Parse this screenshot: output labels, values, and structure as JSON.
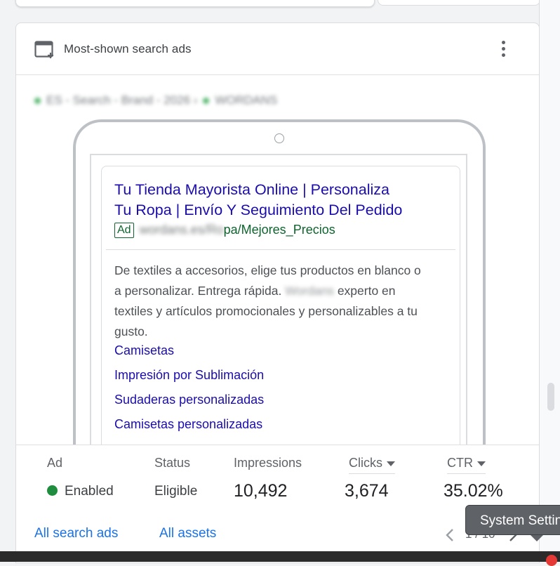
{
  "card": {
    "title": "Most-shown search ads",
    "breadcrumb_campaign": "ES - Search - Brand - 2026",
    "breadcrumb_adgroup": "WORDANS"
  },
  "ad": {
    "headline_line1": "Tu Tienda Mayorista Online | Personaliza",
    "headline_line2": "Tu Ropa | Envío Y Seguimiento Del Pedido",
    "badge": "Ad",
    "url_prefix": "wordans.es/Ro",
    "url_suffix": "pa/Mejores_Precios",
    "desc_part1": "De textiles a accesorios, elige tus productos en blanco o a personalizar. Entrega rápida.",
    "desc_brand": "Wordans",
    "desc_part2": "experto en textiles y artículos promocionales y personalizables a tu gusto.",
    "sitelinks": [
      "Camisetas",
      "Impresión por Sublimación",
      "Sudaderas personalizadas",
      "Camisetas personalizadas"
    ]
  },
  "metrics": {
    "ad_label": "Ad",
    "status_label": "Status",
    "impressions_label": "Impressions",
    "clicks_label": "Clicks",
    "ctr_label": "CTR",
    "ad_state": "Enabled",
    "status_value": "Eligible",
    "impressions": "10,492",
    "clicks": "3,674",
    "ctr": "35.02%",
    "status_color": "#1e8e3e"
  },
  "footer": {
    "all_search_ads": "All search ads",
    "all_assets": "All assets",
    "pager": "1 / 10"
  },
  "tooltip": {
    "text": "System Settings"
  },
  "colors": {
    "link": "#1a73e8",
    "headline": "#1a0dab",
    "url_green": "#0d652d"
  }
}
